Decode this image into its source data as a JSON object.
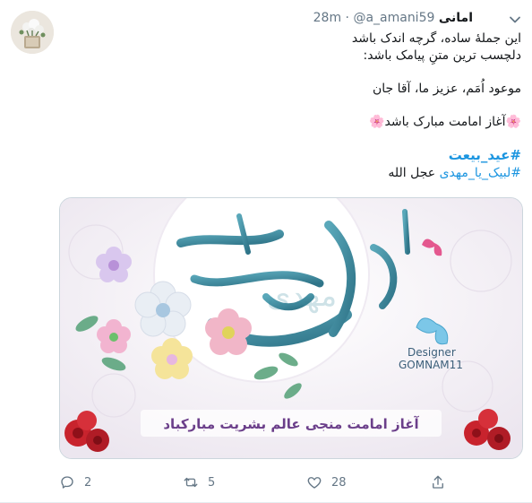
{
  "tweet": {
    "display_name": "امانی",
    "handle": "@a_amani59",
    "separator": "·",
    "time": "28m",
    "lines": [
      "این جملهٔ ساده، گرچه اندک باشد",
      "دلچسب ترین متنِ پیامک باشد:",
      "موعود اُمَم، عزیز ما، آقا جان",
      "آغاز امامت مبارک باشد"
    ],
    "hashtag_1": "#عید_بیعت",
    "hashtag_2": "#لبیک_یا_مهدی",
    "suffix_2": "عجل الله"
  },
  "image": {
    "calligraphy_text": "مهدی",
    "watermark_line1": "Designer",
    "watermark_line2": "GOMNAM11",
    "banner_text": "آغاز امامت منجی عالم بشریت مبارکباد"
  },
  "actions": {
    "replies": "2",
    "retweets": "5",
    "likes": "28"
  },
  "colors": {
    "link": "#1b95e0",
    "calligraphy": "#3f8fa3",
    "banner": "#6b3f8a"
  }
}
